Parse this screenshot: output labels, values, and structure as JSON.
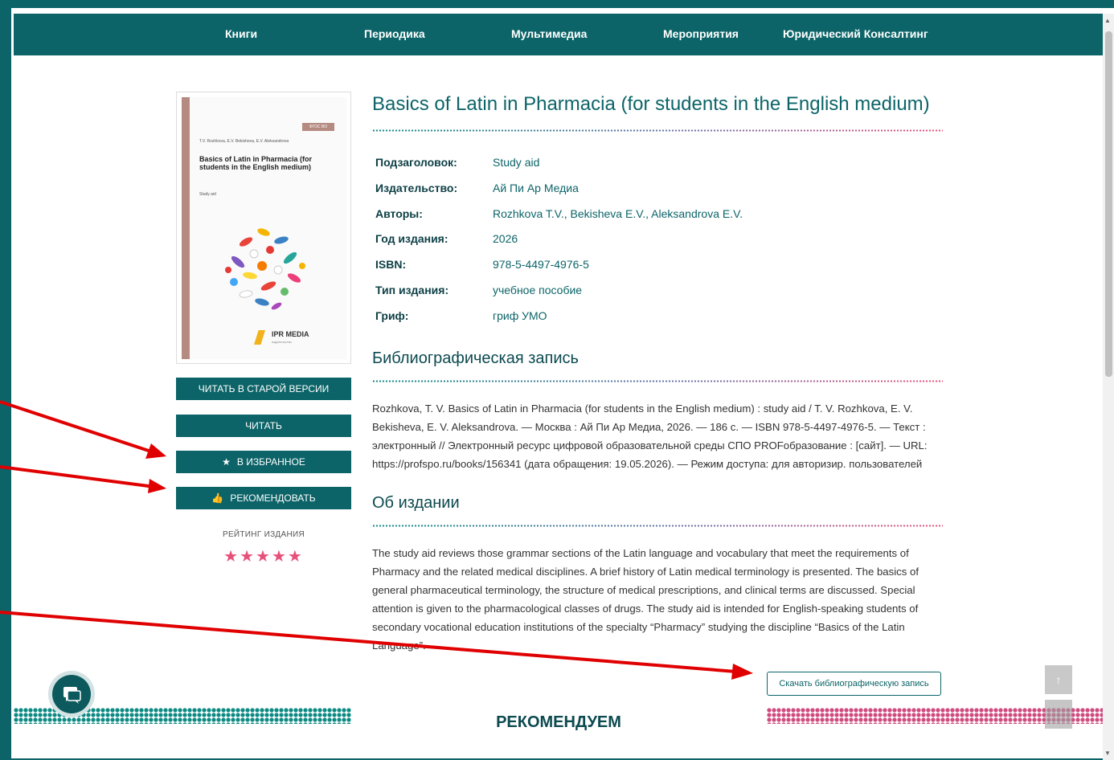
{
  "nav": {
    "items": [
      "Книги",
      "Периодика",
      "Мультимедиа",
      "Мероприятия",
      "Юридический Консалтинг"
    ]
  },
  "cover": {
    "badge": "ФГОС ВО",
    "authors": "T.V. Rozhkova, E.V. Bekisheva, E.V. Aleksandrova",
    "title": "Basics of Latin in Pharmacia (for students in the English medium)",
    "subtitle": "Study aid",
    "publisher_logo": "IPR MEDIA",
    "publisher_logo_sub": "издательство"
  },
  "actions": {
    "read_old": "ЧИТАТЬ В СТАРОЙ ВЕРСИИ",
    "read": "ЧИТАТЬ",
    "favorite": "В ИЗБРАННОЕ",
    "recommend": "РЕКОМЕНДОВАТЬ"
  },
  "rating": {
    "label": "РЕЙТИНГ ИЗДАНИЯ",
    "stars": 5,
    "max": 5
  },
  "book": {
    "title": "Basics of Latin in Pharmacia (for students in the English medium)",
    "meta": [
      {
        "label": "Подзаголовок:",
        "value": "Study aid"
      },
      {
        "label": "Издательство:",
        "value": "Ай Пи Ар Медиа"
      },
      {
        "label": "Авторы:",
        "value": "Rozhkova T.V., Bekisheva E.V., Aleksandrova E.V."
      },
      {
        "label": "Год издания:",
        "value": "2026"
      },
      {
        "label": "ISBN:",
        "value": "978-5-4497-4976-5"
      },
      {
        "label": "Тип издания:",
        "value": "учебное пособие"
      },
      {
        "label": "Гриф:",
        "value": "гриф УМО"
      }
    ]
  },
  "biblio": {
    "heading": "Библиографическая запись",
    "text": "Rozhkova, T. V. Basics of Latin in Pharmacia (for students in the English medium) : study aid / T. V. Rozhkova, E. V. Bekisheva, E. V. Aleksandrova. — Москва : Ай Пи Ар Медиа, 2026. — 186 c. — ISBN 978-5-4497-4976-5. — Текст : электронный // Электронный ресурс цифровой образовательной среды СПО PROFобразование : [сайт]. — URL: https://profspo.ru/books/156341 (дата обращения: 19.05.2026). — Режим доступа: для авторизир. пользователей"
  },
  "about": {
    "heading": "Об издании",
    "text": "The study aid reviews those grammar sections of the Latin language and vocabulary that meet the requirements of Pharmacy and the related medical disciplines. A brief history of Latin medical terminology is presented. The basics of general pharmaceutical terminology, the structure of medical prescriptions, and clinical terms are discussed. Special attention is given to the pharmacological classes of drugs. The study aid is intended for English-speaking students of secondary vocational education institutions of the specialty “Pharmacy” studying the discipline “Basics of the Latin Language”."
  },
  "download": {
    "label": "Скачать библиографическую запись"
  },
  "recommend_section": {
    "title": "РЕКОМЕНДУЕМ"
  },
  "scroll_top": {
    "label": "↑"
  },
  "colors": {
    "primary": "#0c6468",
    "accent_pink": "#e8507a",
    "annotation_arrow": "#e00000"
  }
}
